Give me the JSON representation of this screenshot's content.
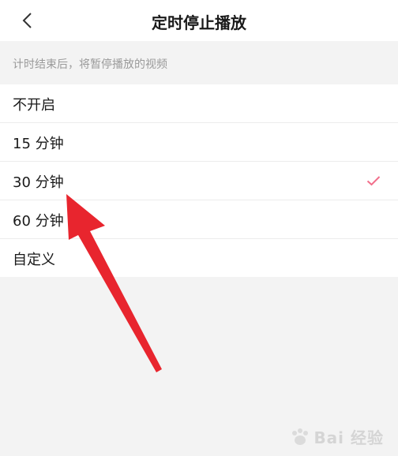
{
  "header": {
    "title": "定时停止播放"
  },
  "hint": {
    "text": "计时结束后，将暂停播放的视频"
  },
  "options": [
    {
      "label": "不开启",
      "selected": false
    },
    {
      "label": "15 分钟",
      "selected": false
    },
    {
      "label": "30 分钟",
      "selected": true
    },
    {
      "label": "60 分钟",
      "selected": false
    },
    {
      "label": "自定义",
      "selected": false
    }
  ],
  "watermark": {
    "text": "Bai 经验"
  },
  "colors": {
    "accent": "#f26f8b",
    "arrow": "#e8252e"
  },
  "icons": {
    "back": "chevron-left-icon",
    "check": "check-icon",
    "watermark_logo": "paw-icon"
  }
}
